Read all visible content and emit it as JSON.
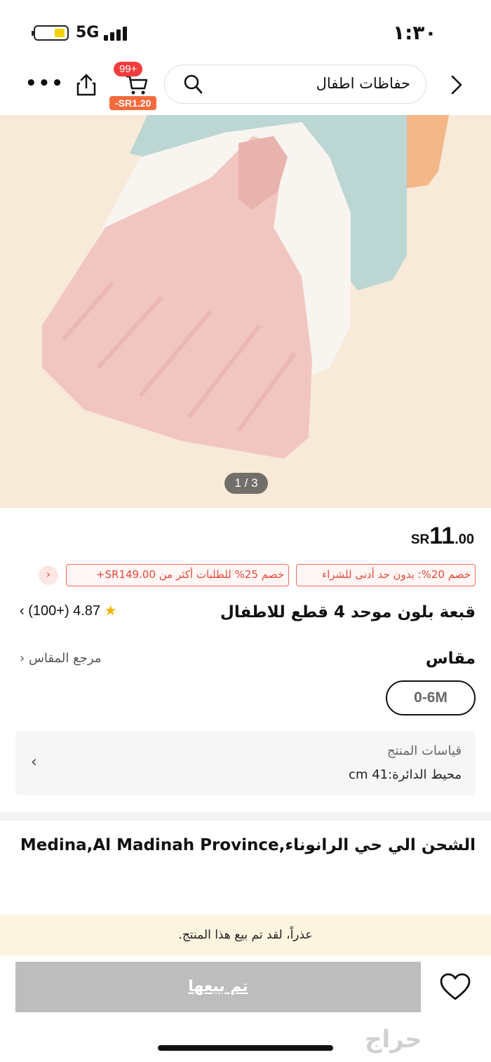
{
  "status_bar": {
    "network": "5G",
    "time": "١:٣٠"
  },
  "header": {
    "search_text": "حفاظات اطفال",
    "cart_count": "99+",
    "cart_discount": "-SR1.20",
    "more_label": "•••"
  },
  "gallery": {
    "pager": "1 / 3"
  },
  "price": {
    "currency": "SR",
    "integer": "11",
    "decimal": ".00"
  },
  "coupons": [
    {
      "label": "خصم 20%: بدون حد أدنى للشراء"
    },
    {
      "label": "خصم 25% للطلبات أكثر من SR149.00+"
    }
  ],
  "product": {
    "title": "قبعة بلون موحد 4 قطع للاطفال",
    "rating": "4.87",
    "reviews": "(100+)"
  },
  "size": {
    "label": "مقاس",
    "reference": "مرجع المقاس",
    "selected": "0-6M"
  },
  "measurements": {
    "title": "قياسات المنتج",
    "value": "محيط الدائرة:41 cm"
  },
  "shipping": {
    "text": "الشحن الي حي الرانوناء,Medina,Al Madinah Province"
  },
  "notice": {
    "text": "عذراً، لقد تم بيع هذا المنتج."
  },
  "cta": {
    "label": "تم بيعها"
  },
  "watermark": {
    "text": "حراج"
  },
  "colors": {
    "accent": "#e64a3b",
    "badge": "#f03c3c",
    "star": "#f5b400",
    "soldout": "#bdbdbd",
    "hero_bg": "#f7e9d6"
  }
}
